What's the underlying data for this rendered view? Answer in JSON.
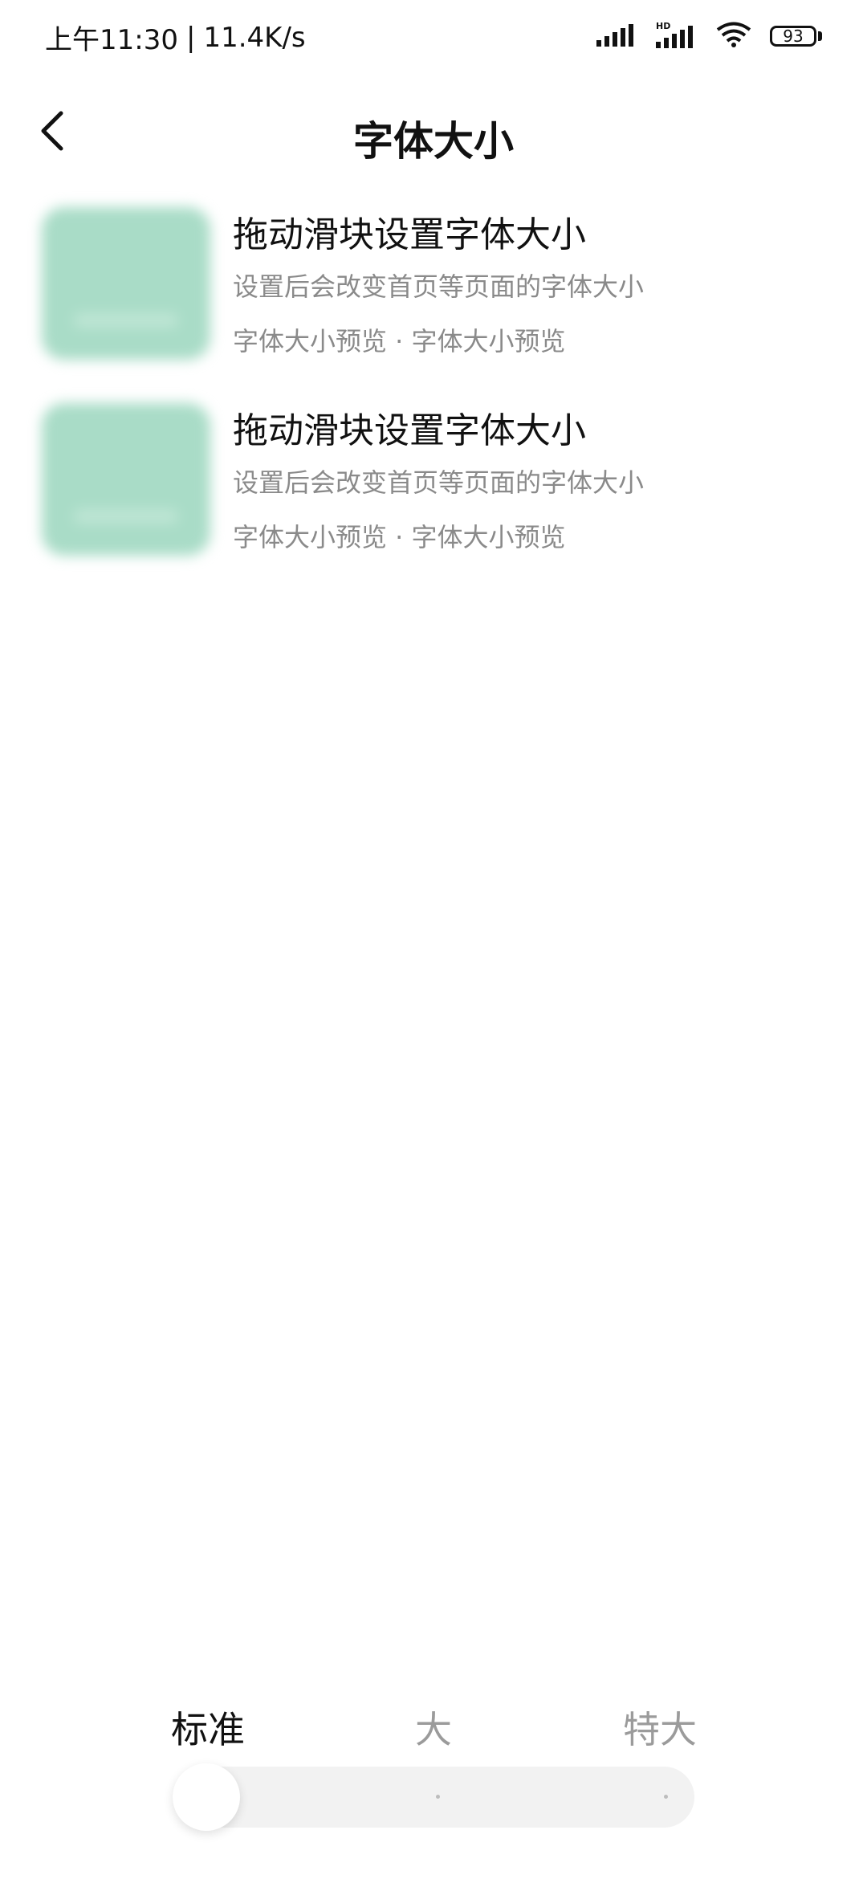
{
  "status_bar": {
    "time": "上午11:30",
    "network_speed": "11.4K/s",
    "battery_level": "93",
    "icons": [
      "signal-icon",
      "hd-signal-icon",
      "wifi-icon",
      "battery-icon"
    ]
  },
  "header": {
    "title": "字体大小",
    "back_icon": "chevron-left-icon"
  },
  "preview_items": [
    {
      "title": "拖动滑块设置字体大小",
      "description": "设置后会改变首页等页面的字体大小",
      "preview": "字体大小预览 · 字体大小预览"
    },
    {
      "title": "拖动滑块设置字体大小",
      "description": "设置后会改变首页等页面的字体大小",
      "preview": "字体大小预览 · 字体大小预览"
    }
  ],
  "font_size_slider": {
    "options": [
      "标准",
      "大",
      "特大"
    ],
    "selected": "标准"
  },
  "colors": {
    "thumbnail": "#a9dcc7",
    "text_primary": "#111111",
    "text_secondary": "#8a8a8a",
    "track": "#f2f2f2"
  }
}
